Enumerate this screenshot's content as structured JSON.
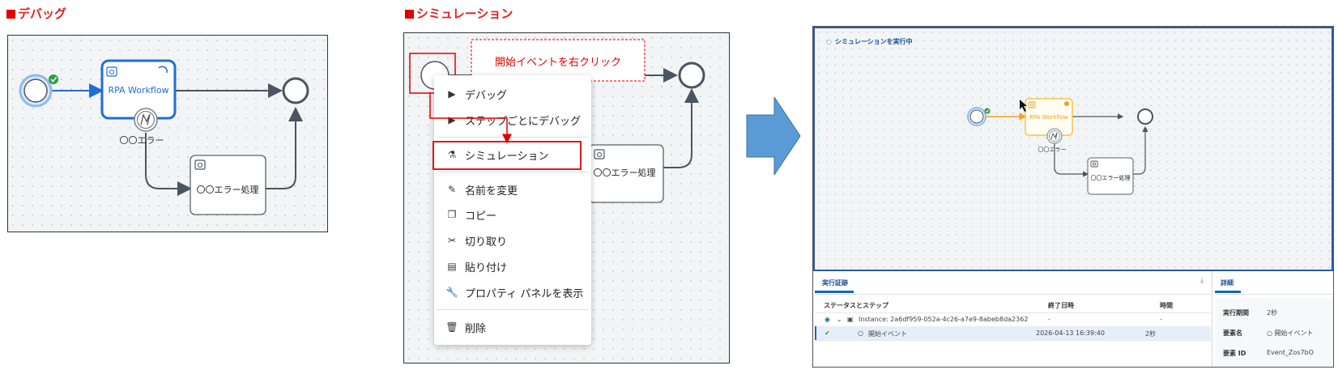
{
  "sections": {
    "debug_title": "デバッグ",
    "simulation_title": "シミュレーション"
  },
  "debug_diagram": {
    "task_label": "RPA Workflow",
    "error_label": "〇〇エラー",
    "error_task_label": "〇〇エラー処理"
  },
  "simulation_diagram": {
    "callout": "開始イベントを右クリック",
    "error_task_label": "〇〇エラー処理"
  },
  "context_menu": {
    "items": [
      {
        "icon": "play-icon",
        "label": "デバッグ"
      },
      {
        "icon": "step-play-icon",
        "label": "ステップごとにデバッグ"
      },
      {
        "icon": "flask-icon",
        "label": "シミュレーション"
      },
      {
        "icon": "pencil-icon",
        "label": "名前を変更"
      },
      {
        "icon": "copy-icon",
        "label": "コピー"
      },
      {
        "icon": "scissors-icon",
        "label": "切り取り"
      },
      {
        "icon": "clipboard-icon",
        "label": "貼り付け"
      },
      {
        "icon": "wrench-icon",
        "label": "プロパティ パネルを表示"
      },
      {
        "icon": "trash-icon",
        "label": "削除"
      }
    ]
  },
  "arrow_color": "#5b9bd5",
  "simulation_view": {
    "status": "シミュレーションを実行中",
    "task_label": "RPA Workflow",
    "error_label": "〇〇エラー",
    "error_task_label": "〇〇エラー処理",
    "left_tab": "実行証跡",
    "right_tab": "詳細",
    "columns": [
      "ステータスとステップ",
      "終了日時",
      "時間"
    ],
    "rows": [
      {
        "name": "Instance: 2a6df959-052a-4c26-a7e9-8abeb8da2362",
        "end": "-",
        "time": "-"
      },
      {
        "name": "開始イベント",
        "end": "2026-04-13 16:39:40",
        "time": "2秒"
      }
    ],
    "details": [
      {
        "label": "実行期間",
        "value": "2秒"
      },
      {
        "label": "要素名",
        "value": "開始イベント"
      },
      {
        "label": "要素 ID",
        "value": "Event_Zos7bO"
      }
    ]
  }
}
